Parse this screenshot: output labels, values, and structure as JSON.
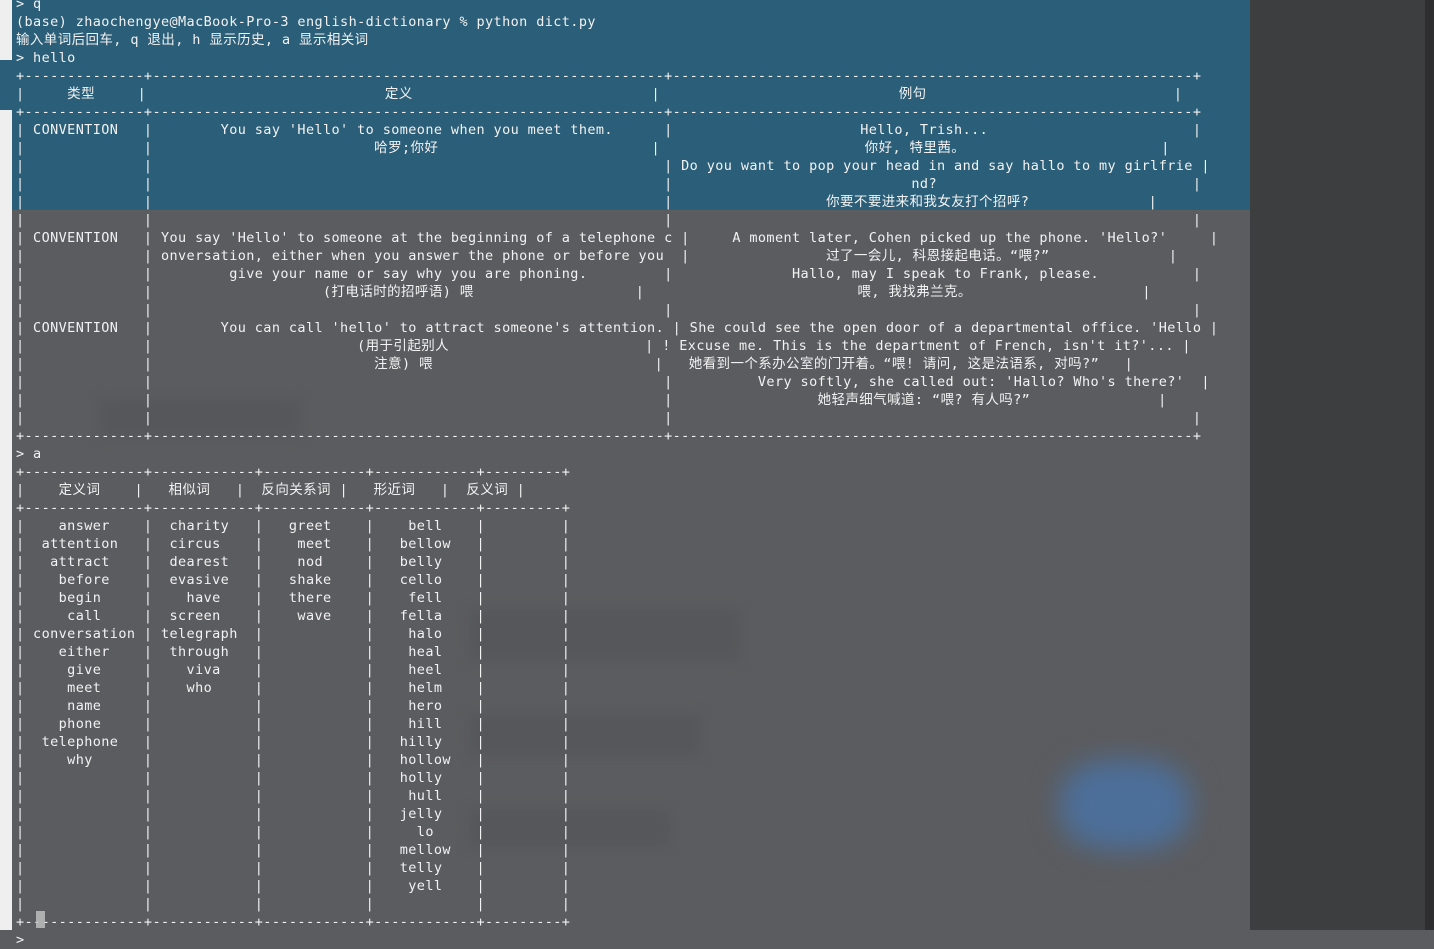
{
  "terminal": {
    "lines": [
      "> q",
      "(base) zhaochengye@MacBook-Pro-3 english-dictionary % python dict.py",
      "输入单词后回车, q 退出, h 显示历史, a 显示相关词",
      "> hello",
      "+--------------+------------------------------------------------------------+-------------------------------------------------------------+",
      "|     类型     |                            定义                            |                            例句                             |",
      "+--------------+------------------------------------------------------------+-------------------------------------------------------------+",
      "| CONVENTION   |        You say 'Hello' to someone when you meet them.      |                      Hello, Trish...                        |",
      "|              |                          哈罗;你好                         |                        你好, 特里茜。                       |",
      "|              |                                                            | Do you want to pop your head in and say hallo to my girlfrie |",
      "|              |                                                            |                            nd?                              |",
      "|              |                                                            |                  你要不要进来和我女友打个招呼?              |",
      "|              |                                                            |                                                             |",
      "| CONVENTION   | You say 'Hello' to someone at the beginning of a telephone c |     A moment later, Cohen picked up the phone. 'Hello?'     |",
      "|              | onversation, either when you answer the phone or before you  |                过了一会儿, 科恩接起电话。“喂?”              |",
      "|              |         give your name or say why you are phoning.         |              Hallo, may I speak to Frank, please.           |",
      "|              |                    (打电话时的招呼语) 喂                   |                         喂, 我找弗兰克。                    |",
      "|              |                                                            |                                                             |",
      "| CONVENTION   |        You can call 'hello' to attract someone's attention. | She could see the open door of a departmental office. 'Hello |",
      "|              |                        (用于引起别人                       | ! Excuse me. This is the department of French, isn't it?'... |",
      "|              |                          注意) 喂                          |   她看到一个系办公室的门开着。“喂! 请问, 这是法语系, 对吗?”   |",
      "|              |                                                            |          Very softly, she called out: 'Hallo? Who's there?'  |",
      "|              |                                                            |                 她轻声细气喊道: “喂? 有人吗?”               |",
      "|              |                                                            |                                                             |",
      "+--------------+------------------------------------------------------------+-------------------------------------------------------------+",
      "> a",
      "+--------------+------------+------------+------------+---------+",
      "|    定义词    |   相似词   |  反向关系词 |   形近词   |  反义词 |",
      "+--------------+------------+------------+------------+---------+",
      "|    answer    |  charity   |   greet    |    bell    |         |",
      "|  attention   |  circus    |    meet    |   bellow   |         |",
      "|   attract    |  dearest   |    nod     |   belly    |         |",
      "|    before    |  evasive   |   shake    |   cello    |         |",
      "|    begin     |    have    |   there    |    fell    |         |",
      "|     call     |  screen    |    wave    |   fella    |         |",
      "| conversation | telegraph  |            |    halo    |         |",
      "|    either    |  through   |            |    heal    |         |",
      "|     give     |    viva    |            |    heel    |         |",
      "|     meet     |    who     |            |    helm    |         |",
      "|     name     |            |            |    hero    |         |",
      "|    phone     |            |            |    hill    |         |",
      "|  telephone   |            |            |   hilly    |         |",
      "|     why      |            |            |   hollow   |         |",
      "|              |            |            |   holly    |         |",
      "|              |            |            |    hull    |         |",
      "|              |            |            |   jelly    |         |",
      "|              |            |            |     lo     |         |",
      "|              |            |            |   mellow   |         |",
      "|              |            |            |   telly    |         |",
      "|              |            |            |    yell    |         |",
      "|              |            |            |            |         |",
      "+--------------+------------+------------+------------+---------+",
      "> "
    ]
  }
}
